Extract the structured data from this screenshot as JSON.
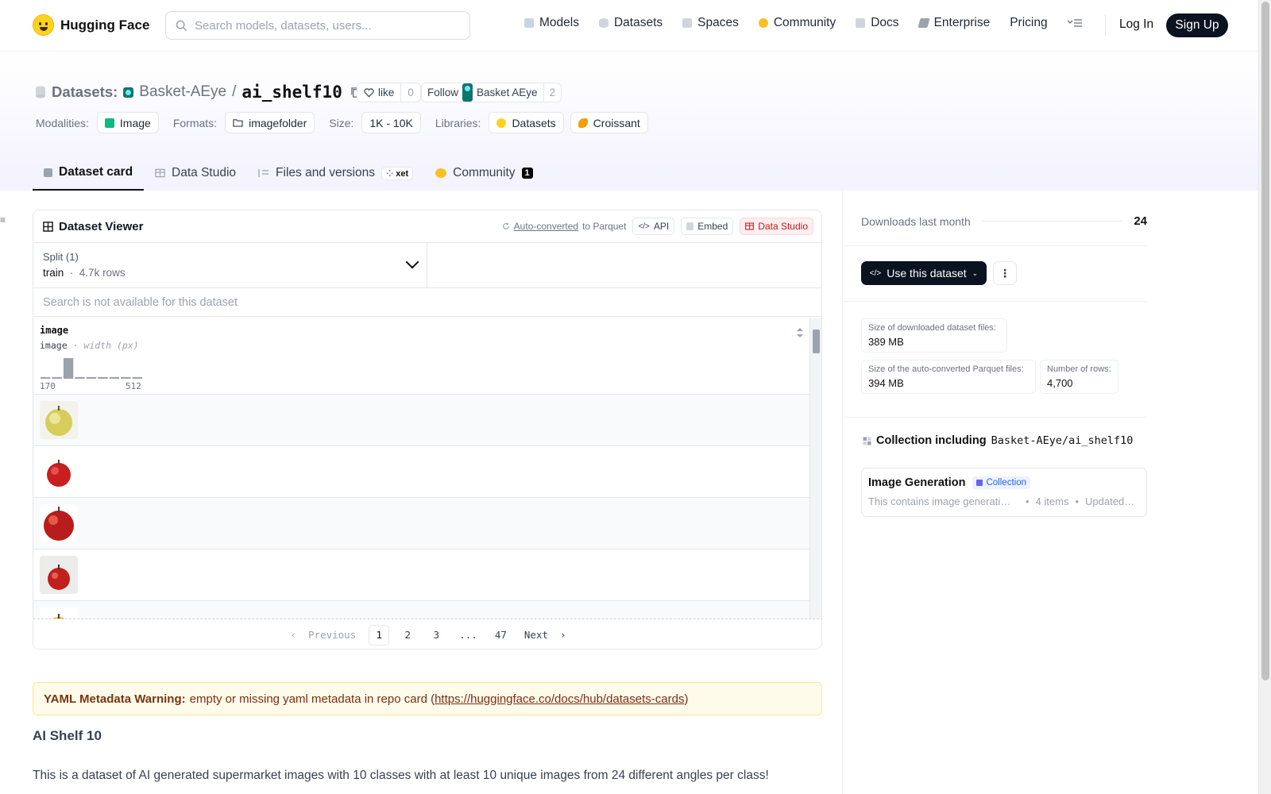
{
  "header": {
    "logo": "Hugging Face",
    "search_placeholder": "Search models, datasets, users...",
    "nav": [
      "Models",
      "Datasets",
      "Spaces",
      "Community",
      "Docs",
      "Enterprise",
      "Pricing"
    ],
    "login": "Log In",
    "signup": "Sign Up"
  },
  "repo": {
    "kind": "Datasets:",
    "owner": "Basket-AEye",
    "slash": "/",
    "name": "ai_shelf10",
    "like_label": "like",
    "like_count": "0",
    "follow_label": "Follow",
    "follow_org": "Basket AEye",
    "follow_count": "2"
  },
  "meta": {
    "modalities_label": "Modalities:",
    "modality": "Image",
    "formats_label": "Formats:",
    "format": "imagefolder",
    "size_label": "Size:",
    "size": "1K - 10K",
    "libraries_label": "Libraries:",
    "libraries": [
      "Datasets",
      "Croissant"
    ]
  },
  "tabs": {
    "dataset_card": "Dataset card",
    "data_studio": "Data Studio",
    "files": "Files and versions",
    "xet": "xet",
    "community": "Community",
    "community_count": "1"
  },
  "viewer": {
    "title": "Dataset Viewer",
    "auto_converted": "Auto-converted",
    "to_parquet": "to Parquet",
    "api": "API",
    "embed": "Embed",
    "data_studio": "Data Studio",
    "split_label": "Split (1)",
    "split_name": "train",
    "split_sep": "·",
    "split_rows": "4.7k rows",
    "search_placeholder": "Search is not available for this dataset",
    "column_name": "image",
    "column_type": "image",
    "column_type_sep": " · ",
    "column_stat": "width (px)",
    "hist_min": "170",
    "hist_max": "512",
    "histogram": [
      0.08,
      0.08,
      1.0,
      0.08,
      0.08,
      0.08,
      0.08,
      0.08,
      0.08
    ],
    "pager": {
      "previous": "Previous",
      "pages": [
        "1",
        "2",
        "3",
        "...",
        "47"
      ],
      "next": "Next"
    }
  },
  "warning": {
    "label": "YAML Metadata Warning:",
    "text": "empty or missing yaml metadata in repo card (",
    "link": "https://huggingface.co/docs/hub/datasets-cards",
    "close": ")"
  },
  "card": {
    "heading": "AI Shelf 10",
    "paragraph": "This is a dataset of AI generated supermarket images with 10 classes with at least 10 unique images from 24 different angles per class!"
  },
  "sidebar": {
    "downloads_label": "Downloads last month",
    "downloads": "24",
    "use_button": "Use this dataset",
    "stats": [
      {
        "label": "Size of downloaded dataset files:",
        "value": "389 MB"
      },
      {
        "label": "Size of the auto-converted Parquet files:",
        "value": "394 MB"
      },
      {
        "label": "Number of rows:",
        "value": "4,700"
      }
    ],
    "collection_heading": "Collection including",
    "collection_repo": "Basket-AEye/ai_shelf10",
    "collection": {
      "name": "Image Generation",
      "badge": "Collection",
      "desc": "This contains image generati…",
      "items": "4 items",
      "updated": "Updated…"
    }
  },
  "colors": {
    "accent_dark": "#0b1220",
    "hf_yellow": "#ffd21e",
    "warning_bg": "#fffbeb"
  }
}
